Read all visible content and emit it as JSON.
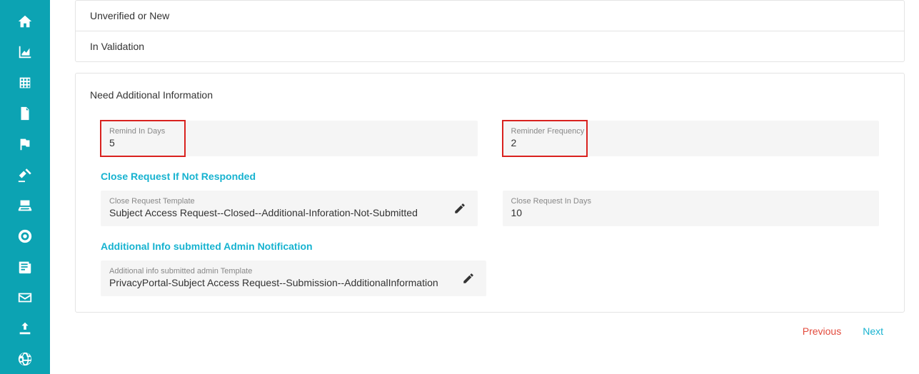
{
  "sidebar": {
    "items": [
      {
        "name": "home-icon"
      },
      {
        "name": "chart-icon"
      },
      {
        "name": "grid-icon"
      },
      {
        "name": "document-icon"
      },
      {
        "name": "flag-icon"
      },
      {
        "name": "gavel-icon"
      },
      {
        "name": "drive-icon"
      },
      {
        "name": "lifebuoy-icon"
      },
      {
        "name": "news-icon"
      },
      {
        "name": "mail-icon"
      },
      {
        "name": "upload-icon"
      },
      {
        "name": "globe-icon"
      }
    ]
  },
  "status_rows": {
    "row1": "Unverified or New",
    "row2": "In Validation"
  },
  "card": {
    "title": "Need Additional Information",
    "remind_in_days": {
      "label": "Remind In Days",
      "value": "5"
    },
    "reminder_frequency": {
      "label": "Reminder Frequency",
      "value": "2"
    },
    "close_heading": "Close Request If Not Responded",
    "close_template": {
      "label": "Close Request Template",
      "value": "Subject Access Request--Closed--Additional-Inforation-Not-Submitted"
    },
    "close_days": {
      "label": "Close Request In Days",
      "value": "10"
    },
    "admin_heading": "Additional Info submitted Admin Notification",
    "admin_template": {
      "label": "Additional info submitted admin Template",
      "value": "PrivacyPortal-Subject Access Request--Submission--AdditionalInformation"
    }
  },
  "footer": {
    "previous": "Previous",
    "next": "Next"
  }
}
